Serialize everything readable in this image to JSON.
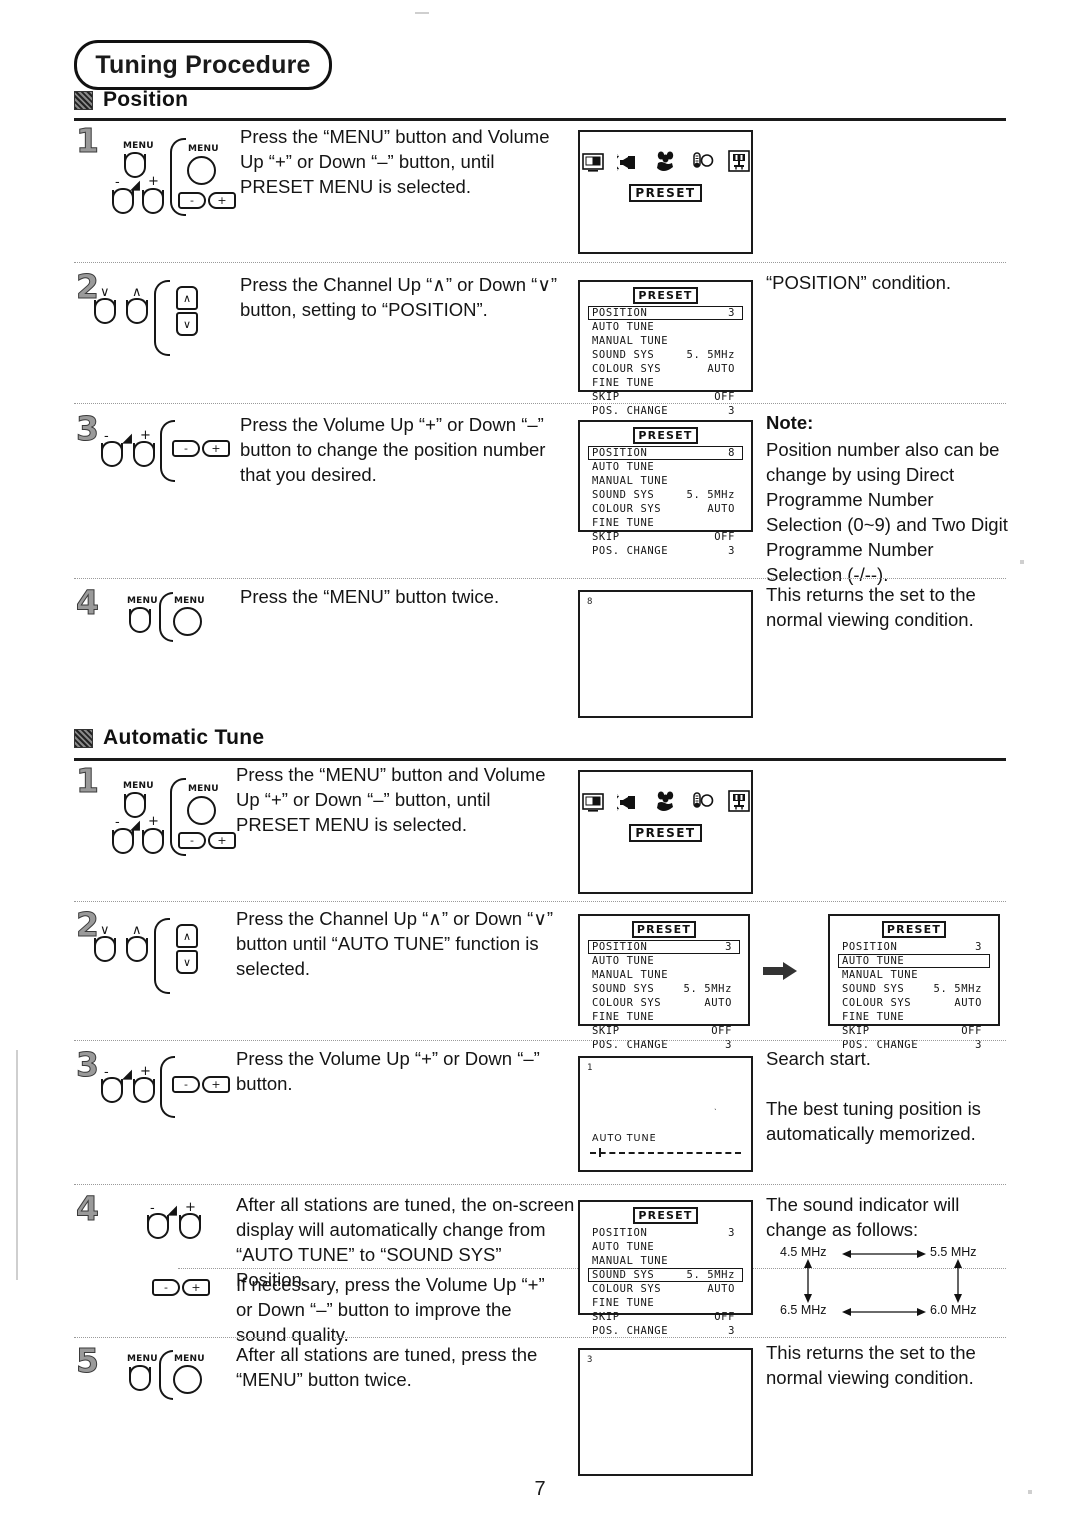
{
  "page": {
    "title": "Tuning Procedure",
    "number": "7"
  },
  "sections": [
    {
      "id": "position",
      "heading": "Position",
      "steps": [
        {
          "number": "1",
          "instruction": "Press the “MENU” button and Volume\nUp “+” or Down “–” button, until\nPRESET MENU is selected.",
          "right_text": "",
          "controls": {
            "set_menu_label": "MENU",
            "remote_menu_label": "MENU",
            "volume_minus": "-",
            "volume_plus": "+",
            "rocker_minus": "-",
            "rocker_plus": "+"
          },
          "screen": {
            "type": "icon-menu",
            "icons": [
              "picture-icon",
              "sound-icon",
              "feature-icon",
              "contrast-icon",
              "install-icon"
            ],
            "tag": "PRESET"
          }
        },
        {
          "number": "2",
          "instruction": "Press the Channel Up “∧” or Down “∨”\nbutton, setting to “POSITION”.",
          "right_text": "“POSITION” condition.",
          "controls": {
            "ch_down": "∨",
            "ch_up": "∧",
            "rocker_up": "∧",
            "rocker_down": "∨"
          },
          "screen": {
            "type": "osd",
            "title": "PRESET",
            "selected": 0,
            "rows": [
              {
                "key": "POSITION",
                "value": "3"
              },
              {
                "key": "AUTO TUNE",
                "value": ""
              },
              {
                "key": "MANUAL TUNE",
                "value": ""
              },
              {
                "key": "SOUND SYS",
                "value": "5. 5MHz"
              },
              {
                "key": "COLOUR SYS",
                "value": "AUTO"
              },
              {
                "key": "FINE TUNE",
                "value": ""
              },
              {
                "key": "SKIP",
                "value": "OFF"
              },
              {
                "key": "POS. CHANGE",
                "value": "3"
              }
            ]
          }
        },
        {
          "number": "3",
          "instruction": "Press the Volume Up “+” or Down “–”\nbutton to change the position number\nthat you desired.",
          "note_title": "Note:",
          "right_text": "Position number also can be\nchange by using Direct\nProgramme Number\nSelection (0~9) and Two Digit\nProgramme Number\nSelection (-/--).",
          "controls": {
            "volume_minus": "-",
            "volume_plus": "+",
            "rocker_minus": "-",
            "rocker_plus": "+"
          },
          "screen": {
            "type": "osd",
            "title": "PRESET",
            "selected": 0,
            "rows": [
              {
                "key": "POSITION",
                "value": "8"
              },
              {
                "key": "AUTO TUNE",
                "value": ""
              },
              {
                "key": "MANUAL TUNE",
                "value": ""
              },
              {
                "key": "SOUND SYS",
                "value": "5. 5MHz"
              },
              {
                "key": "COLOUR SYS",
                "value": "AUTO"
              },
              {
                "key": "FINE TUNE",
                "value": ""
              },
              {
                "key": "SKIP",
                "value": "OFF"
              },
              {
                "key": "POS. CHANGE",
                "value": "3"
              }
            ]
          }
        },
        {
          "number": "4",
          "instruction": "Press the “MENU” button twice.",
          "right_text": "This returns the set to the\nnormal viewing condition.",
          "controls": {
            "set_menu_label": "MENU",
            "remote_menu_label": "MENU"
          },
          "screen": {
            "type": "blank",
            "corner_number": "8"
          }
        }
      ]
    },
    {
      "id": "automatic-tune",
      "heading": "Automatic Tune",
      "steps": [
        {
          "number": "1",
          "instruction": "Press the “MENU” button and Volume\nUp “+” or Down “–” button, until\nPRESET MENU is selected.",
          "right_text": "",
          "controls": {
            "set_menu_label": "MENU",
            "remote_menu_label": "MENU",
            "volume_minus": "-",
            "volume_plus": "+",
            "rocker_minus": "-",
            "rocker_plus": "+"
          },
          "screen": {
            "type": "icon-menu",
            "icons": [
              "picture-icon",
              "sound-icon",
              "feature-icon",
              "contrast-icon",
              "install-icon"
            ],
            "tag": "PRESET"
          }
        },
        {
          "number": "2",
          "instruction": "Press the Channel Up “∧” or Down “∨”\nbutton until “AUTO TUNE” function is\nselected.",
          "right_text": "",
          "controls": {
            "ch_down": "∨",
            "ch_up": "∧",
            "rocker_up": "∧",
            "rocker_down": "∨"
          },
          "screen": {
            "type": "osd-pair",
            "before": {
              "title": "PRESET",
              "selected": 0,
              "rows": [
                {
                  "key": "POSITION",
                  "value": "3"
                },
                {
                  "key": "AUTO TUNE",
                  "value": ""
                },
                {
                  "key": "MANUAL TUNE",
                  "value": ""
                },
                {
                  "key": "SOUND SYS",
                  "value": "5. 5MHz"
                },
                {
                  "key": "COLOUR SYS",
                  "value": "AUTO"
                },
                {
                  "key": "FINE TUNE",
                  "value": ""
                },
                {
                  "key": "SKIP",
                  "value": "OFF"
                },
                {
                  "key": "POS. CHANGE",
                  "value": "3"
                }
              ]
            },
            "after": {
              "title": "PRESET",
              "selected": 1,
              "rows": [
                {
                  "key": "POSITION",
                  "value": "3"
                },
                {
                  "key": "AUTO TUNE",
                  "value": ""
                },
                {
                  "key": "MANUAL TUNE",
                  "value": ""
                },
                {
                  "key": "SOUND SYS",
                  "value": "5. 5MHz"
                },
                {
                  "key": "COLOUR SYS",
                  "value": "AUTO"
                },
                {
                  "key": "FINE TUNE",
                  "value": ""
                },
                {
                  "key": "SKIP",
                  "value": "OFF"
                },
                {
                  "key": "POS. CHANGE",
                  "value": "3"
                }
              ]
            }
          }
        },
        {
          "number": "3",
          "instruction": "Press the Volume Up “+” or Down “–”\nbutton.",
          "right_text": "Search start.\n\nThe best tuning position is\nautomatically memorized.",
          "controls": {
            "volume_minus": "-",
            "volume_plus": "+",
            "rocker_minus": "-",
            "rocker_plus": "+"
          },
          "screen": {
            "type": "auto-tune",
            "corner_number": "1",
            "label": "AUTO TUNE"
          }
        },
        {
          "number": "4",
          "instruction": "After all stations are tuned, the on-screen\ndisplay will automatically change from\n“AUTO TUNE” to “SOUND SYS” Position.",
          "instruction_b": "If necessary, press the Volume Up “+”\nor Down “–” button to improve the\nsound quality.",
          "right_text": "The sound indicator will\nchange as follows:",
          "controls": {
            "volume_minus": "-",
            "volume_plus": "+",
            "rocker_minus": "-",
            "rocker_plus": "+"
          },
          "screen": {
            "type": "osd",
            "title": "PRESET",
            "selected": 3,
            "rows": [
              {
                "key": "POSITION",
                "value": "3"
              },
              {
                "key": "AUTO TUNE",
                "value": ""
              },
              {
                "key": "MANUAL TUNE",
                "value": ""
              },
              {
                "key": "SOUND SYS",
                "value": "5. 5MHz"
              },
              {
                "key": "COLOUR SYS",
                "value": "AUTO"
              },
              {
                "key": "FINE TUNE",
                "value": ""
              },
              {
                "key": "SKIP",
                "value": "OFF"
              },
              {
                "key": "POS. CHANGE",
                "value": "3"
              }
            ]
          },
          "cycle_diagram": {
            "top_left": "4.5 MHz",
            "top_right": "5.5 MHz",
            "bottom_left": "6.5 MHz",
            "bottom_right": "6.0 MHz"
          }
        },
        {
          "number": "5",
          "instruction": "After all stations are tuned, press the\n“MENU” button twice.",
          "right_text": "This returns the set to the\nnormal viewing condition.",
          "controls": {
            "set_menu_label": "MENU",
            "remote_menu_label": "MENU"
          },
          "screen": {
            "type": "blank",
            "corner_number": "3"
          }
        }
      ]
    }
  ]
}
